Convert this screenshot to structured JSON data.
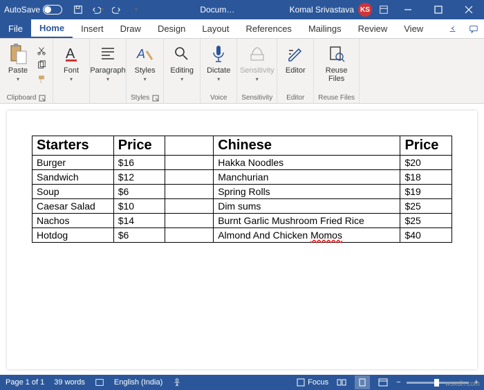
{
  "titlebar": {
    "autosave": "AutoSave",
    "doc": "Docum…",
    "user": "Komal Srivastava",
    "initials": "KS"
  },
  "tabs": {
    "file": "File",
    "home": "Home",
    "insert": "Insert",
    "draw": "Draw",
    "design": "Design",
    "layout": "Layout",
    "references": "References",
    "mailings": "Mailings",
    "review": "Review",
    "view": "View"
  },
  "ribbon": {
    "paste": "Paste",
    "clipboard": "Clipboard",
    "font": "Font",
    "paragraph": "Paragraph",
    "styles": "Styles",
    "styles_group": "Styles",
    "editing": "Editing",
    "dictate": "Dictate",
    "voice": "Voice",
    "sensitivity": "Sensitivity",
    "sensitivity_group": "Sensitivity",
    "editor": "Editor",
    "editor_group": "Editor",
    "reuse": "Reuse Files",
    "reuse_group": "Reuse Files"
  },
  "table": {
    "h1": "Starters",
    "h2": "Price",
    "h3": "Chinese",
    "h4": "Price",
    "rows": [
      {
        "a": "Burger",
        "ap": "$16",
        "c": "Hakka Noodles",
        "cp": "$20"
      },
      {
        "a": "Sandwich",
        "ap": "$12",
        "c": "Manchurian",
        "cp": "$18"
      },
      {
        "a": "Soup",
        "ap": "$6",
        "c": "Spring Rolls",
        "cp": "$19"
      },
      {
        "a": "Caesar Salad",
        "ap": "$10",
        "c": "Dim sums",
        "cp": "$25"
      },
      {
        "a": "Nachos",
        "ap": "$14",
        "c": "Burnt Garlic Mushroom Fried Rice",
        "cp": "$25"
      },
      {
        "a": "Hotdog",
        "ap": "$6",
        "c": "Almond And Chicken ",
        "c2": "Momos",
        "cp": "$40"
      }
    ]
  },
  "status": {
    "page": "Page 1 of 1",
    "words": "39 words",
    "lang": "English (India)",
    "focus": "Focus"
  },
  "watermark": "wsxdh.com"
}
